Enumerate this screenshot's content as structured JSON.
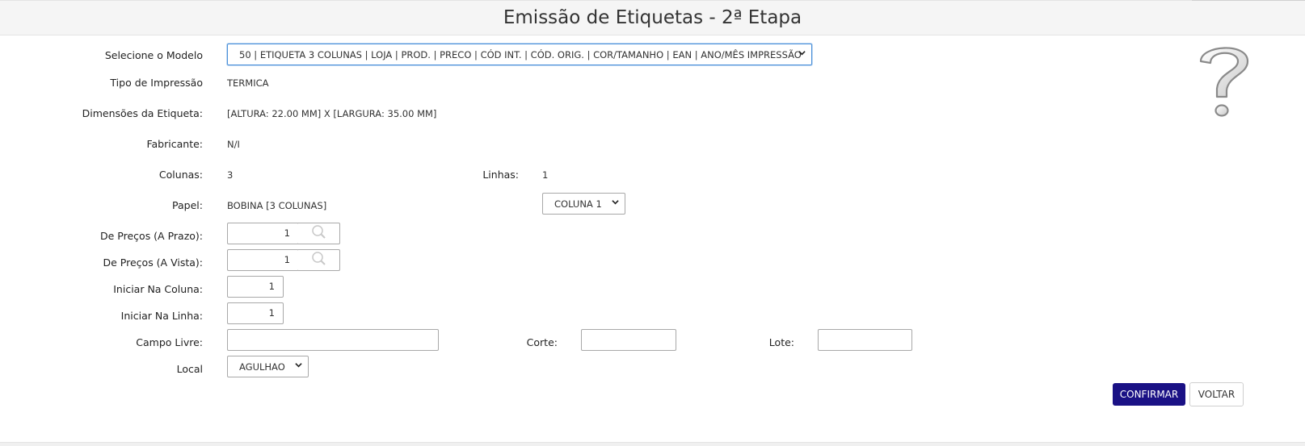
{
  "header": {
    "title": "Emissão de Etiquetas - 2ª Etapa"
  },
  "form": {
    "modelo": {
      "label": "Selecione o Modelo",
      "value": "50 | ETIQUETA 3 COLUNAS | LOJA | PROD. | PRECO | CÓD INT. | CÓD. ORIG. | COR/TAMANHO | EAN | ANO/MÊS IMPRESSÃO"
    },
    "tipo_impressao": {
      "label": "Tipo de Impressão",
      "value": "TERMICA"
    },
    "dimensoes": {
      "label": "Dimensões da Etiqueta:",
      "value": "[ALTURA: 22.00 MM] X [LARGURA: 35.00 MM]"
    },
    "fabricante": {
      "label": "Fabricante:",
      "value": "N/I"
    },
    "colunas": {
      "label": "Colunas:",
      "value": "3"
    },
    "linhas": {
      "label": "Linhas:",
      "value": "1"
    },
    "papel": {
      "label": "Papel:",
      "value": "BOBINA [3 COLUNAS]"
    },
    "coluna_select": {
      "value": "COLUNA 1"
    },
    "precos_prazo": {
      "label": "De Preços (A Prazo):",
      "value": "1"
    },
    "precos_vista": {
      "label": "De Preços (A Vista):",
      "value": "1"
    },
    "iniciar_coluna": {
      "label": "Iniciar Na Coluna:",
      "value": "1"
    },
    "iniciar_linha": {
      "label": "Iniciar Na Linha:",
      "value": "1"
    },
    "campo_livre": {
      "label": "Campo Livre:",
      "value": ""
    },
    "corte": {
      "label": "Corte:",
      "value": ""
    },
    "lote": {
      "label": "Lote:",
      "value": ""
    },
    "local": {
      "label": "Local",
      "value": "AGULHAO"
    }
  },
  "actions": {
    "confirm": "CONFIRMAR",
    "back": "VOLTAR"
  },
  "icons": {
    "help": "question-mark-icon",
    "lookup": "magnifier-icon",
    "dropdown": "chevron-down-icon"
  },
  "colors": {
    "primary": "#1a1185",
    "focus": "#4a90d9"
  }
}
